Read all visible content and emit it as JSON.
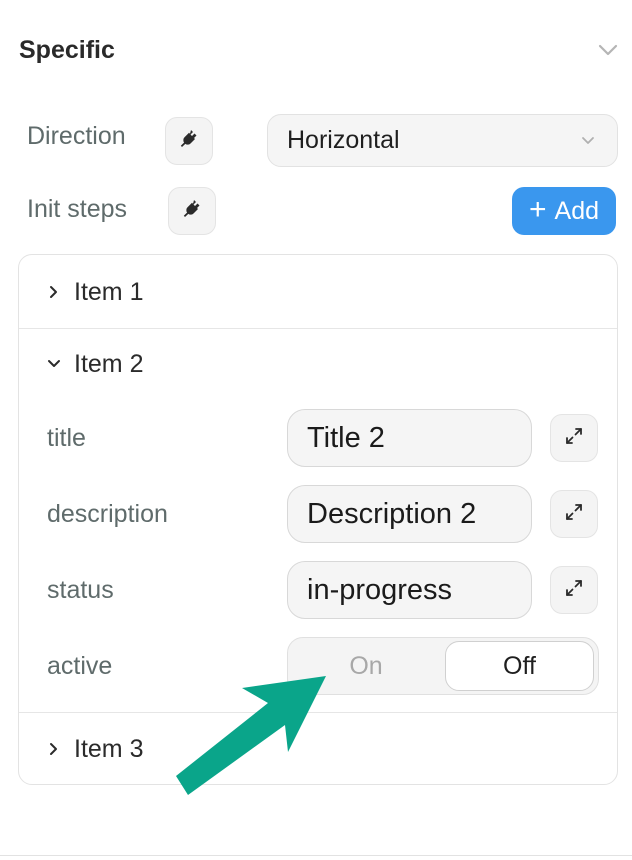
{
  "section": {
    "title": "Specific"
  },
  "direction": {
    "label": "Direction",
    "value": "Horizontal"
  },
  "init_steps": {
    "label": "Init steps",
    "add_label": "Add"
  },
  "items": [
    {
      "label": "Item 1",
      "expanded": false
    },
    {
      "label": "Item 2",
      "expanded": true,
      "fields": {
        "title": {
          "label": "title",
          "value": "Title 2"
        },
        "description": {
          "label": "description",
          "value": "Description 2"
        },
        "status": {
          "label": "status",
          "value": "in-progress"
        },
        "active": {
          "label": "active",
          "on_label": "On",
          "off_label": "Off",
          "selected": "Off"
        }
      }
    },
    {
      "label": "Item 3",
      "expanded": false
    }
  ],
  "colors": {
    "accent": "#3a97ee",
    "annotation_arrow": "#0aa58a"
  },
  "icons": [
    "chevron-down-icon",
    "plug-icon",
    "plus-icon",
    "chevron-right-icon",
    "expand-icon",
    "arrow-annotation"
  ]
}
